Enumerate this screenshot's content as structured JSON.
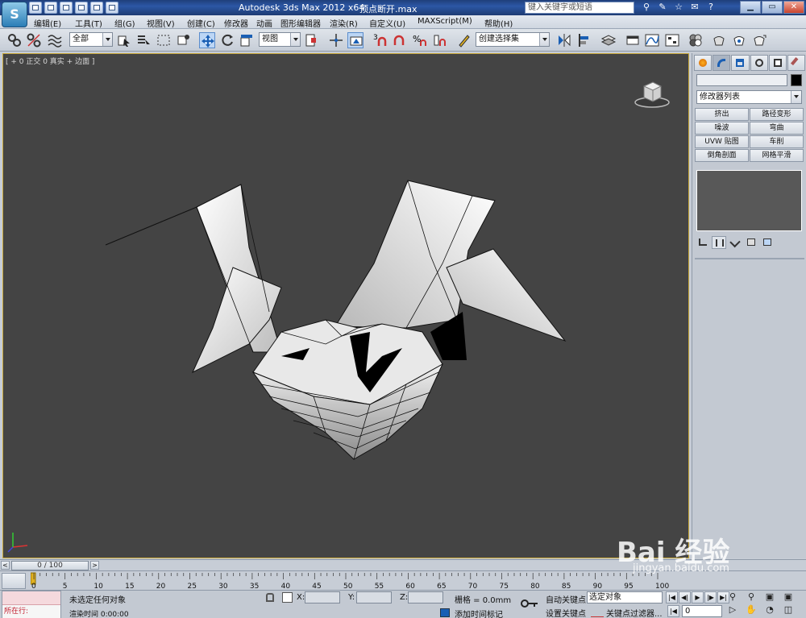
{
  "window": {
    "app_title": "Autodesk 3ds Max  2012 x64",
    "file_title": "顶点断开.max",
    "search_placeholder": "键入关键字或短语",
    "minimize": "▁",
    "restore": "▭",
    "close": "✕"
  },
  "menu": [
    {
      "label": "编辑(E)"
    },
    {
      "label": "工具(T)"
    },
    {
      "label": "组(G)"
    },
    {
      "label": "视图(V)"
    },
    {
      "label": "创建(C)"
    },
    {
      "label": "修改器"
    },
    {
      "label": "动画"
    },
    {
      "label": "图形编辑器"
    },
    {
      "label": "渲染(R)"
    },
    {
      "label": "自定义(U)"
    },
    {
      "label": "MAXScript(M)"
    },
    {
      "label": "帮助(H)"
    }
  ],
  "toolbar": {
    "selection_filter": "全部",
    "ref_coord": "视图",
    "named_selection": "创建选择集"
  },
  "viewport": {
    "label": "[ + 0 正交 0 真实 + 边面 ]",
    "background": "#444444",
    "border_color": "#c8a83a"
  },
  "command_panel": {
    "modifier_list": "修改器列表",
    "modifiers": [
      {
        "label": "挤出"
      },
      {
        "label": "路径变形"
      },
      {
        "label": "噪波"
      },
      {
        "label": "弯曲"
      },
      {
        "label": "UVW 贴图"
      },
      {
        "label": "车削"
      },
      {
        "label": "倒角剖面"
      },
      {
        "label": "网格平滑"
      }
    ]
  },
  "timeslider": {
    "position": "0 / 100",
    "prev": "<",
    "next": ">"
  },
  "trackbar": {
    "ticks": [
      "0",
      "5",
      "10",
      "15",
      "20",
      "25",
      "30",
      "35",
      "40",
      "45",
      "50",
      "55",
      "60",
      "65",
      "70",
      "75",
      "80",
      "85",
      "90",
      "95",
      "100"
    ]
  },
  "status": {
    "maxscript_prompt": "所在行:",
    "selection_status": "未选定任何对象",
    "render_time": "渲染时间  0:00:00",
    "x_label": "X:",
    "y_label": "Y:",
    "z_label": "Z:",
    "grid": "栅格 = 0.0mm",
    "add_time_tag": "添加时间标记",
    "auto_key": "自动关键点",
    "set_key": "设置关键点",
    "selected_object": "选定对象",
    "key_filters": "关键点过滤器...",
    "current_frame": "0"
  },
  "watermark": {
    "brand": "Bai 经验",
    "url": "jingyan.baidu.com"
  }
}
